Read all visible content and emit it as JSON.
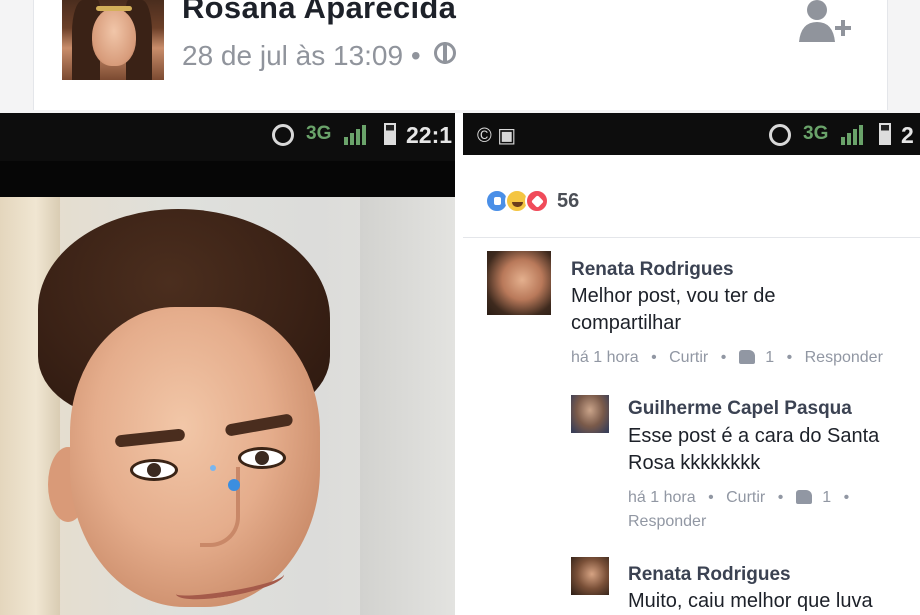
{
  "post": {
    "author": "Rosana Aparecida",
    "timestamp": "28 de jul às 13:09",
    "separator": "•",
    "privacy_icon": "globe-icon",
    "add_friend_icon": "add-friend-icon"
  },
  "left_screenshot": {
    "status_bar": {
      "network": "3G",
      "time": "22:1"
    }
  },
  "right_screenshot": {
    "status_bar": {
      "network": "3G",
      "time": "2",
      "left_icons": "© ▣"
    },
    "reactions": {
      "types": [
        "like",
        "haha",
        "love"
      ],
      "count": "56"
    },
    "comments": [
      {
        "author": "Renata Rodrigues",
        "text_lines": [
          "Melhor post,  vou ter de",
          "compartilhar"
        ],
        "time": "há 1 hora",
        "like_label": "Curtir",
        "likes": "1",
        "reply_label": "Responder"
      },
      {
        "author": "Guilherme Capel Pasqua",
        "text_lines": [
          "Esse post é a cara do Santa",
          "Rosa kkkkkkkk"
        ],
        "time": "há 1 hora",
        "like_label": "Curtir",
        "likes": "1",
        "reply_label": "Responder"
      },
      {
        "author": "Renata Rodrigues",
        "text_lines": [
          "Muito, caiu melhor que luva"
        ]
      }
    ]
  },
  "colors": {
    "name_text": "#1d2129",
    "meta_text": "#90949c",
    "like_blue": "#4a8fe7",
    "haha_yellow": "#f4c542",
    "love_red": "#f04b5a",
    "network_green": "#6aa36a"
  }
}
